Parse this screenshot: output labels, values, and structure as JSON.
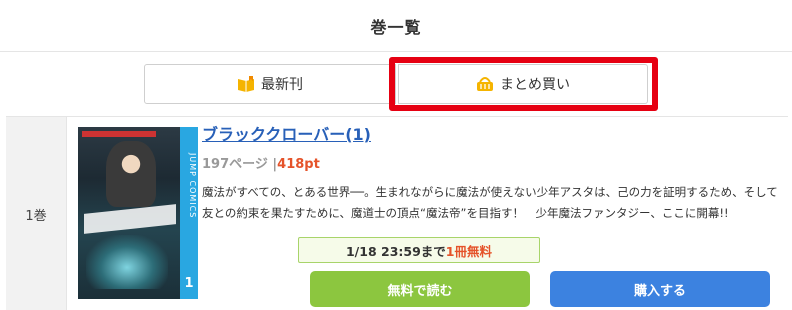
{
  "header": {
    "title": "巻一覧"
  },
  "tabs": {
    "latest_label": "最新刊",
    "bulk_label": "まとめ買い"
  },
  "highlight_color": "#e60012",
  "volume": {
    "label": "1巻",
    "title": "ブラッククローバー(1)",
    "pages": "197ページ",
    "separator": "|",
    "points": "418pt",
    "description": "魔法がすべての、とある世界──。生まれながらに魔法が使えない少年アスタは、己の力を証明するため、そして友との約束を果たすために、魔道士の頂点“魔法帝”を目指す！　少年魔法ファンタジー、ここに開幕!!",
    "cover": {
      "spine_text": "JUMP COMICS",
      "spine_number": "1"
    },
    "free_badge": {
      "deadline": "1/18 23:59まで",
      "free_text": "1冊無料"
    },
    "read_button": "無料で読む",
    "buy_button": "購入する"
  },
  "colors": {
    "link": "#2860b8",
    "points": "#e5532a",
    "read_button": "#8cc63f",
    "buy_button": "#3c82e0"
  }
}
